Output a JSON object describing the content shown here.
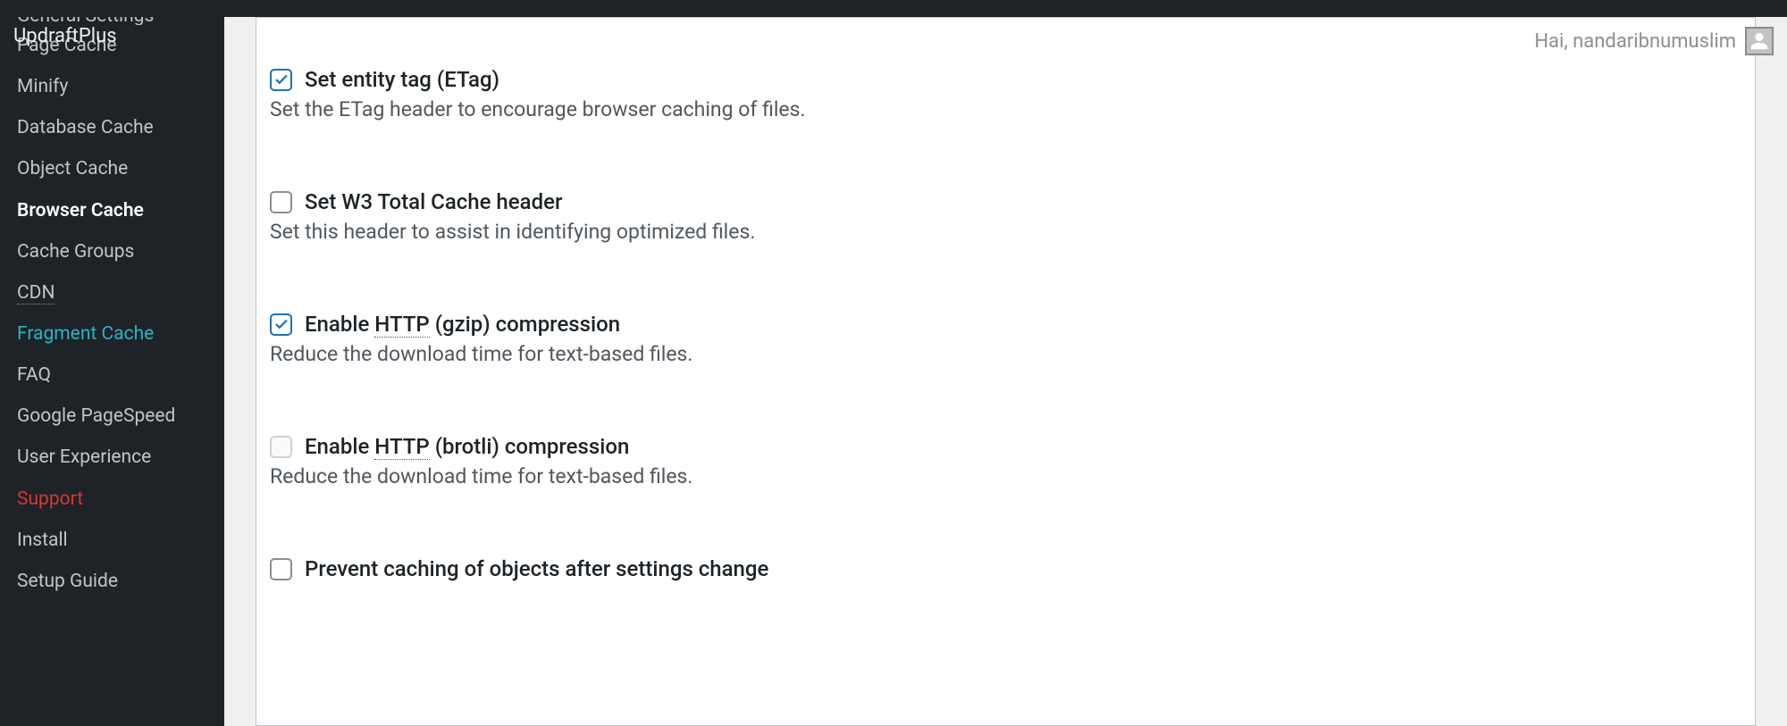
{
  "topbar": {
    "updraft": "UpdraftPlus"
  },
  "greeting": "Hai, nandaribnumuslim",
  "sidebar": {
    "items": [
      {
        "label": "General Settings"
      },
      {
        "label": "Page Cache"
      },
      {
        "label": "Minify"
      },
      {
        "label": "Database Cache"
      },
      {
        "label": "Object Cache"
      },
      {
        "label": "Browser Cache"
      },
      {
        "label": "Cache Groups"
      },
      {
        "label": "CDN"
      },
      {
        "label": "Fragment Cache"
      },
      {
        "label": "FAQ"
      },
      {
        "label": "Google PageSpeed"
      },
      {
        "label": "User Experience"
      },
      {
        "label": "Support"
      },
      {
        "label": "Install"
      },
      {
        "label": "Setup Guide"
      }
    ]
  },
  "settings": [
    {
      "label_pre": "Set entity tag (ETag)",
      "desc": "Set the ETag header to encourage browser caching of files."
    },
    {
      "label_pre": "Set W3 Total Cache header",
      "desc": "Set this header to assist in identifying optimized files."
    },
    {
      "enable": "Enable ",
      "http": "HTTP",
      "post": " (gzip) compression",
      "desc": "Reduce the download time for text-based files."
    },
    {
      "enable": "Enable ",
      "http": "HTTP",
      "post": " (brotli) compression",
      "desc": "Reduce the download time for text-based files."
    },
    {
      "label_pre": "Prevent caching of objects after settings change"
    }
  ]
}
